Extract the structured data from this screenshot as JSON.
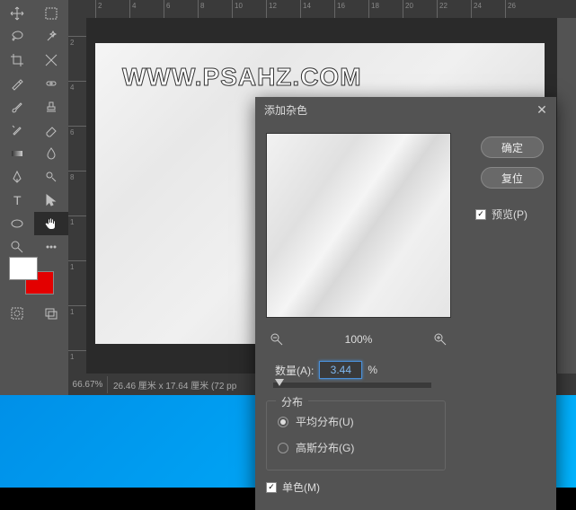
{
  "canvas_watermark": "WWW.PSAHZ.COM",
  "status": {
    "zoom": "66.67%",
    "doc_info": "26.46 厘米 x 17.64 厘米 (72 pp"
  },
  "ruler_h": [
    "2",
    "4",
    "6",
    "8",
    "10",
    "12",
    "14",
    "16",
    "18",
    "20",
    "22",
    "24",
    "26"
  ],
  "ruler_v": [
    "2",
    "4",
    "6",
    "8",
    "1",
    "1",
    "1",
    "1"
  ],
  "dialog": {
    "title": "添加杂色",
    "ok": "确定",
    "reset": "复位",
    "preview_label": "预览(P)",
    "zoom_level": "100%",
    "amount_label": "数量(A):",
    "amount_value": "3.44",
    "percent": "%",
    "group_title": "分布",
    "uniform": "平均分布(U)",
    "gaussian": "高斯分布(G)",
    "mono": "单色(M)"
  }
}
